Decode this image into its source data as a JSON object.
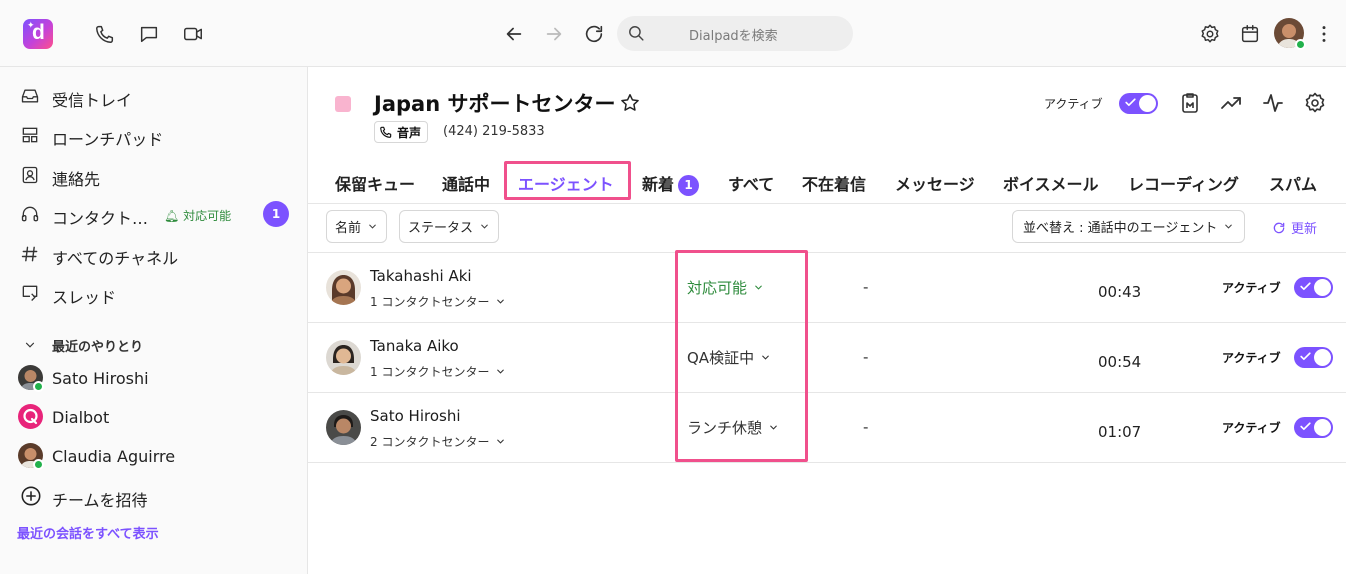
{
  "header": {
    "search_placeholder": "Dialpadを検索"
  },
  "sidebar": {
    "items": [
      {
        "label": "受信トレイ",
        "icon": "inbox-icon"
      },
      {
        "label": "ローンチパッド",
        "icon": "launchpad-icon"
      },
      {
        "label": "連絡先",
        "icon": "contacts-icon"
      },
      {
        "label": "コンタクト…",
        "icon": "headset-icon",
        "status": "対応可能",
        "badge": "1"
      },
      {
        "label": "すべてのチャネル",
        "icon": "hash-icon"
      },
      {
        "label": "スレッド",
        "icon": "threads-icon"
      }
    ],
    "recent_title": "最近のやりとり",
    "recent": [
      {
        "name": "Sato Hiroshi",
        "online": true
      },
      {
        "name": "Dialbot",
        "online": false
      },
      {
        "name": "Claudia Aguirre",
        "online": true
      }
    ],
    "invite_label": "チームを招待",
    "see_all_label": "最近の会話をすべて表示"
  },
  "main": {
    "title": "Japan サポートセンター",
    "swatch_color": "#f9b4cf",
    "voice_label": "音声",
    "phone_number": "(424) 219-5833",
    "active_label": "アクティブ",
    "tabs": [
      {
        "label": "保留キュー"
      },
      {
        "label": "通話中"
      },
      {
        "label": "エージェント",
        "active": true
      },
      {
        "label": "新着",
        "badge": "1"
      },
      {
        "label": "すべて"
      },
      {
        "label": "不在着信"
      },
      {
        "label": "メッセージ"
      },
      {
        "label": "ボイスメール"
      },
      {
        "label": "レコーディング"
      },
      {
        "label": "スパム"
      }
    ],
    "filters": {
      "name_label": "名前",
      "status_label": "ステータス",
      "sort_label": "並べ替え : 通話中のエージェント",
      "refresh_label": "更新"
    },
    "agents": [
      {
        "name": "Takahashi Aki",
        "contact_centers": "1 コンタクトセンター",
        "status": "対応可能",
        "status_color": "#2e8b3c",
        "call": "-",
        "time": "00:43",
        "active_label": "アクティブ"
      },
      {
        "name": "Tanaka Aiko",
        "contact_centers": "1 コンタクトセンター",
        "status": "QA検証中",
        "status_color": "#333333",
        "call": "-",
        "time": "00:54",
        "active_label": "アクティブ"
      },
      {
        "name": "Sato Hiroshi",
        "contact_centers": "2 コンタクトセンター",
        "status": "ランチ休憩",
        "status_color": "#333333",
        "call": "-",
        "time": "01:07",
        "active_label": "アクティブ"
      }
    ]
  },
  "colors": {
    "accent": "#7c52ff",
    "highlight": "#f0508c",
    "available": "#2e8b3c"
  }
}
